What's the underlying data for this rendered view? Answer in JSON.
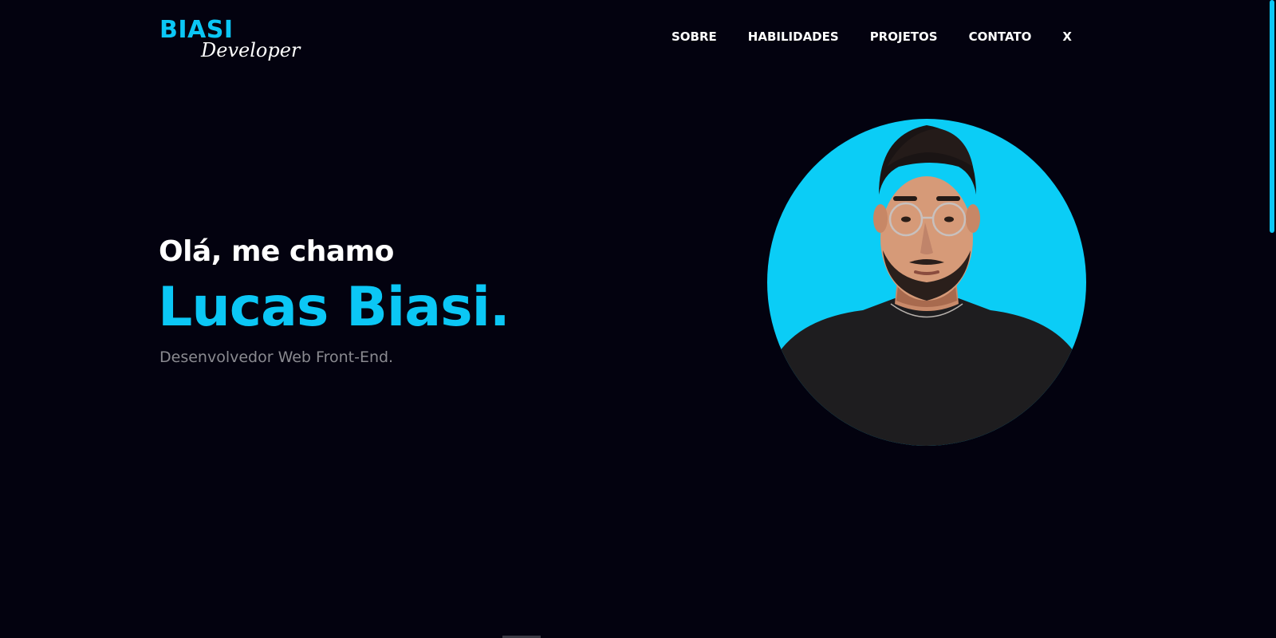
{
  "header": {
    "logo_main": "BIASI",
    "logo_sub": "Developer",
    "nav": [
      {
        "label": "SOBRE"
      },
      {
        "label": "HABILIDADES"
      },
      {
        "label": "PROJETOS"
      },
      {
        "label": "CONTATO"
      },
      {
        "label": "X"
      }
    ]
  },
  "hero": {
    "greeting": "Olá, me chamo",
    "name": "Lucas Biasi.",
    "role": "Desenvolvedor Web Front-End."
  },
  "colors": {
    "background": "#03020f",
    "accent": "#0bc7f5",
    "text": "#ffffff",
    "muted": "#8a8a90"
  },
  "icons": {
    "avatar": "profile-photo"
  }
}
